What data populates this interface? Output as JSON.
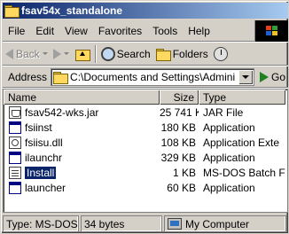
{
  "window": {
    "title": "fsav54x_standalone"
  },
  "menu": {
    "items": [
      "File",
      "Edit",
      "View",
      "Favorites",
      "Tools",
      "Help"
    ]
  },
  "toolbar": {
    "back_label": "Back",
    "search_label": "Search",
    "folders_label": "Folders"
  },
  "address": {
    "label": "Address",
    "value": "C:\\Documents and Settings\\Administr",
    "go_label": "Go"
  },
  "columns": {
    "name": "Name",
    "size": "Size",
    "type": "Type"
  },
  "files": [
    {
      "name": "fsav542-wks.jar",
      "size": "25 741 KB",
      "type": "JAR File",
      "icon": "jar-file-icon"
    },
    {
      "name": "fsiinst",
      "size": "180 KB",
      "type": "Application",
      "icon": "application-icon"
    },
    {
      "name": "fsiisu.dll",
      "size": "108 KB",
      "type": "Application Exte",
      "icon": "dll-file-icon"
    },
    {
      "name": "ilaunchr",
      "size": "329 KB",
      "type": "Application",
      "icon": "application-icon"
    },
    {
      "name": "Install",
      "size": "1 KB",
      "type": "MS-DOS Batch F",
      "icon": "batch-file-icon",
      "selected": true
    },
    {
      "name": "launcher",
      "size": "60 KB",
      "type": "Application",
      "icon": "application-icon"
    }
  ],
  "status": {
    "type_text": "Type: MS-DOS Ba",
    "size_text": "34 bytes",
    "location_text": "My Computer"
  },
  "colors": {
    "title_start": "#0a246a",
    "title_end": "#a6caf0",
    "chrome": "#d4d0c8",
    "selection": "#0a246a"
  }
}
